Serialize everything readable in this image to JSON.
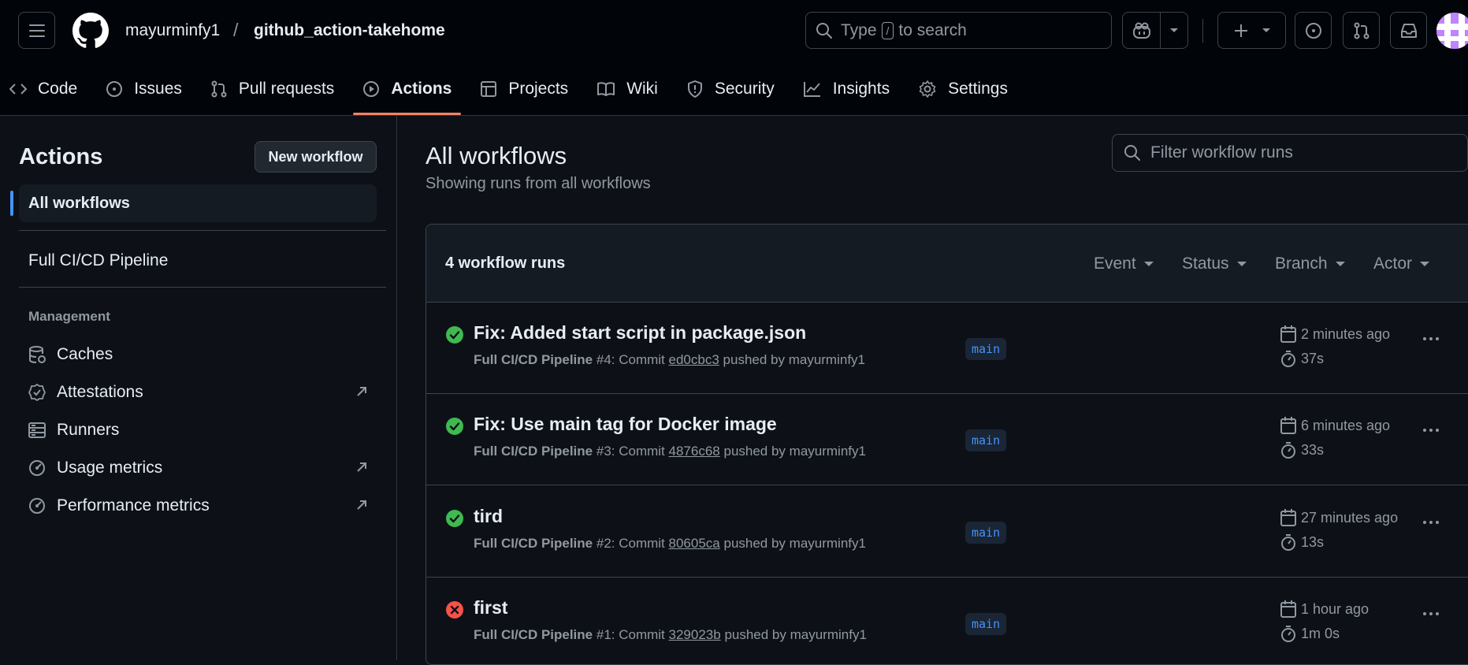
{
  "header": {
    "owner": "mayurminfy1",
    "separator": "/",
    "repo": "github_action-takehome",
    "search_before": "Type",
    "search_key": "/",
    "search_after": "to search"
  },
  "tabs": [
    {
      "label": "Code",
      "icon": "code-icon"
    },
    {
      "label": "Issues",
      "icon": "issue-icon"
    },
    {
      "label": "Pull requests",
      "icon": "pull-request-icon"
    },
    {
      "label": "Actions",
      "icon": "play-icon"
    },
    {
      "label": "Projects",
      "icon": "table-icon"
    },
    {
      "label": "Wiki",
      "icon": "book-icon"
    },
    {
      "label": "Security",
      "icon": "shield-icon"
    },
    {
      "label": "Insights",
      "icon": "graph-icon"
    },
    {
      "label": "Settings",
      "icon": "gear-icon"
    }
  ],
  "sidebar": {
    "title": "Actions",
    "new_workflow": "New workflow",
    "all_workflows": "All workflows",
    "workflow": "Full CI/CD Pipeline",
    "management_heading": "Management",
    "management": [
      {
        "label": "Caches"
      },
      {
        "label": "Attestations"
      },
      {
        "label": "Runners"
      },
      {
        "label": "Usage metrics"
      },
      {
        "label": "Performance metrics"
      }
    ]
  },
  "main": {
    "title": "All workflows",
    "subtitle": "Showing runs from all workflows",
    "filter_placeholder": "Filter workflow runs",
    "runs_count": "4 workflow runs",
    "filters": [
      "Event",
      "Status",
      "Branch",
      "Actor"
    ]
  },
  "runs": [
    {
      "title": "Fix: Added start script in package.json",
      "workflow": "Full CI/CD Pipeline",
      "number": "#4: Commit",
      "sha": "ed0cbc3",
      "pushed": "pushed by mayurminfy1",
      "branch": "main",
      "time": "2 minutes ago",
      "duration": "37s",
      "status": "success"
    },
    {
      "title": "Fix: Use main tag for Docker image",
      "workflow": "Full CI/CD Pipeline",
      "number": "#3: Commit",
      "sha": "4876c68",
      "pushed": "pushed by mayurminfy1",
      "branch": "main",
      "time": "6 minutes ago",
      "duration": "33s",
      "status": "success"
    },
    {
      "title": "tird",
      "workflow": "Full CI/CD Pipeline",
      "number": "#2: Commit",
      "sha": "80605ca",
      "pushed": "pushed by mayurminfy1",
      "branch": "main",
      "time": "27 minutes ago",
      "duration": "13s",
      "status": "success"
    },
    {
      "title": "first",
      "workflow": "Full CI/CD Pipeline",
      "number": "#1: Commit",
      "sha": "329023b",
      "pushed": "pushed by mayurminfy1",
      "branch": "main",
      "time": "1 hour ago",
      "duration": "1m 0s",
      "status": "failure"
    }
  ],
  "colors": {
    "success": "#3fb950",
    "failure": "#f85149",
    "accent": "#4493f8",
    "tab_underline": "#f78166"
  }
}
